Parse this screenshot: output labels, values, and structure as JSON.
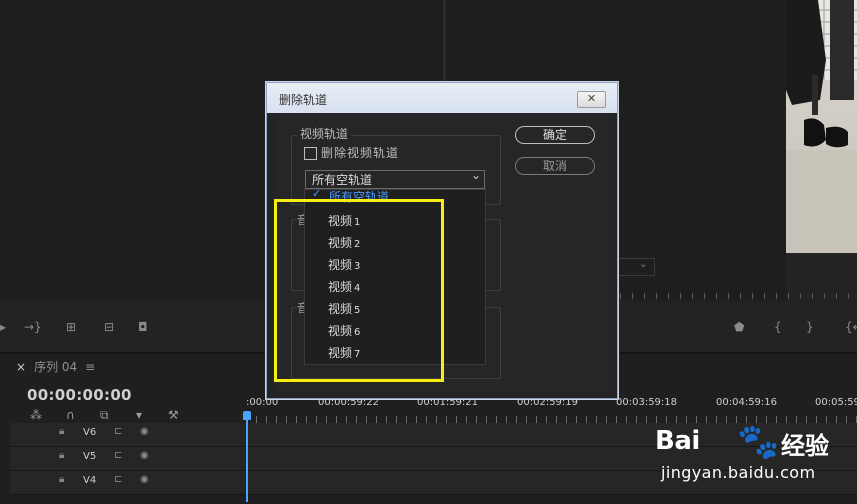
{
  "dialog": {
    "title": "删除轨道",
    "close_glyph": "✕",
    "video_group_legend": "视频轨道",
    "delete_video_checkbox_label": "删除视频轨道",
    "select_value": "所有空轨道",
    "select_arrow": "⌄",
    "ok_button": "确定",
    "cancel_button": "取消",
    "list_first_item": "所有空轨道",
    "list_check": "✓",
    "list_items": [
      {
        "label": "视频",
        "num": "1"
      },
      {
        "label": "视频",
        "num": "2"
      },
      {
        "label": "视频",
        "num": "3"
      },
      {
        "label": "视频",
        "num": "4"
      },
      {
        "label": "视频",
        "num": "5"
      },
      {
        "label": "视频",
        "num": "6"
      },
      {
        "label": "视频",
        "num": "7"
      }
    ],
    "ghost_audio_legend_1": "音",
    "ghost_audio_legend_2": "音"
  },
  "timeline": {
    "tab_close": "×",
    "sequence_name": "序列 04",
    "tab_menu": "≡",
    "timecode": "00:00:00:00",
    "ruler_labels": [
      ":00:00",
      "00:00:59:22",
      "00:01:59:21",
      "00:02:59:19",
      "00:03:59:18",
      "00:04:59:16",
      "00:05:59"
    ],
    "tracks": [
      "V6",
      "V5",
      "V4"
    ]
  },
  "highlight_color": "#f4ee11",
  "watermark": {
    "logo_text": "Bai",
    "logo_paw": "🐾",
    "logo_cn": "经验",
    "url": "jingyan.baidu.com"
  }
}
